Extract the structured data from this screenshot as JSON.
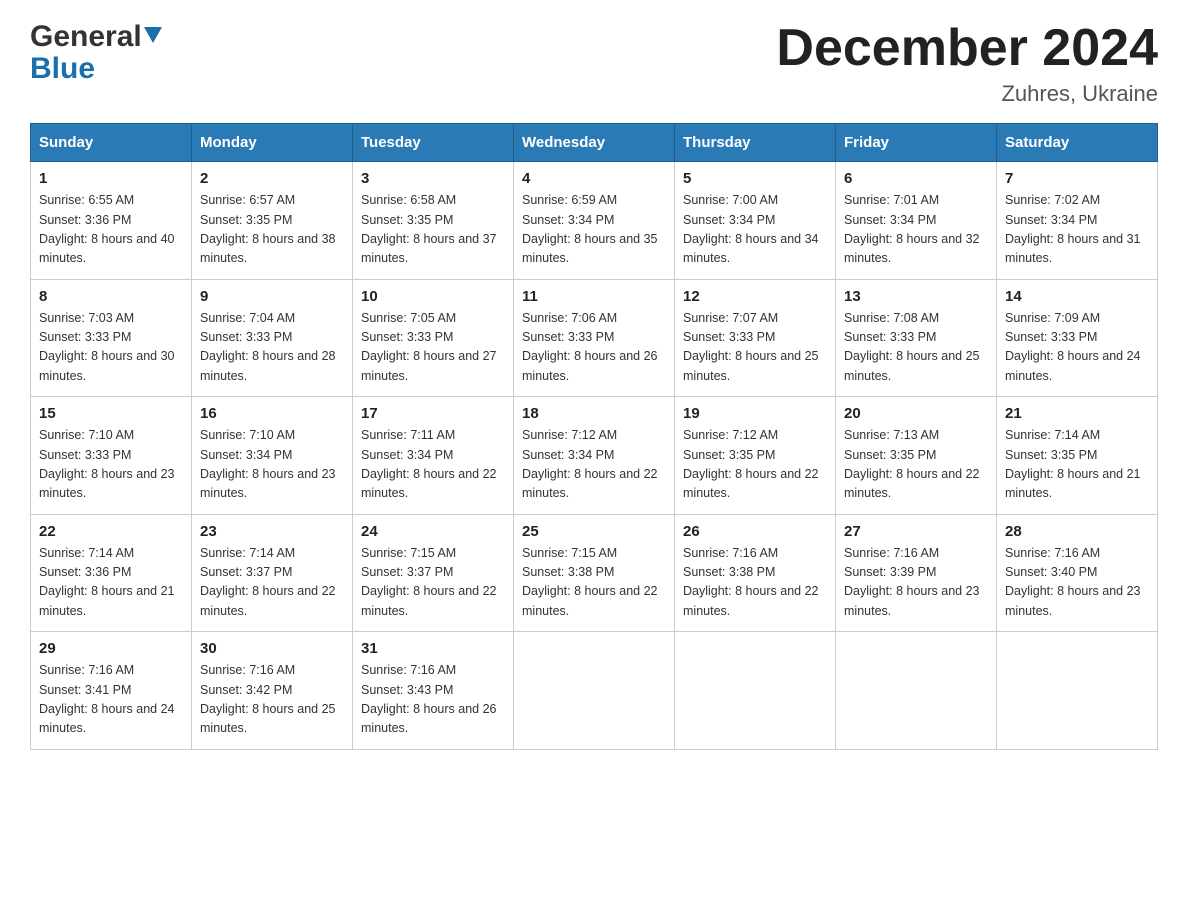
{
  "header": {
    "logo_general": "General",
    "logo_blue": "Blue",
    "month_title": "December 2024",
    "location": "Zuhres, Ukraine"
  },
  "days_of_week": [
    "Sunday",
    "Monday",
    "Tuesday",
    "Wednesday",
    "Thursday",
    "Friday",
    "Saturday"
  ],
  "weeks": [
    [
      {
        "day": "1",
        "sunrise": "6:55 AM",
        "sunset": "3:36 PM",
        "daylight": "8 hours and 40 minutes."
      },
      {
        "day": "2",
        "sunrise": "6:57 AM",
        "sunset": "3:35 PM",
        "daylight": "8 hours and 38 minutes."
      },
      {
        "day": "3",
        "sunrise": "6:58 AM",
        "sunset": "3:35 PM",
        "daylight": "8 hours and 37 minutes."
      },
      {
        "day": "4",
        "sunrise": "6:59 AM",
        "sunset": "3:34 PM",
        "daylight": "8 hours and 35 minutes."
      },
      {
        "day": "5",
        "sunrise": "7:00 AM",
        "sunset": "3:34 PM",
        "daylight": "8 hours and 34 minutes."
      },
      {
        "day": "6",
        "sunrise": "7:01 AM",
        "sunset": "3:34 PM",
        "daylight": "8 hours and 32 minutes."
      },
      {
        "day": "7",
        "sunrise": "7:02 AM",
        "sunset": "3:34 PM",
        "daylight": "8 hours and 31 minutes."
      }
    ],
    [
      {
        "day": "8",
        "sunrise": "7:03 AM",
        "sunset": "3:33 PM",
        "daylight": "8 hours and 30 minutes."
      },
      {
        "day": "9",
        "sunrise": "7:04 AM",
        "sunset": "3:33 PM",
        "daylight": "8 hours and 28 minutes."
      },
      {
        "day": "10",
        "sunrise": "7:05 AM",
        "sunset": "3:33 PM",
        "daylight": "8 hours and 27 minutes."
      },
      {
        "day": "11",
        "sunrise": "7:06 AM",
        "sunset": "3:33 PM",
        "daylight": "8 hours and 26 minutes."
      },
      {
        "day": "12",
        "sunrise": "7:07 AM",
        "sunset": "3:33 PM",
        "daylight": "8 hours and 25 minutes."
      },
      {
        "day": "13",
        "sunrise": "7:08 AM",
        "sunset": "3:33 PM",
        "daylight": "8 hours and 25 minutes."
      },
      {
        "day": "14",
        "sunrise": "7:09 AM",
        "sunset": "3:33 PM",
        "daylight": "8 hours and 24 minutes."
      }
    ],
    [
      {
        "day": "15",
        "sunrise": "7:10 AM",
        "sunset": "3:33 PM",
        "daylight": "8 hours and 23 minutes."
      },
      {
        "day": "16",
        "sunrise": "7:10 AM",
        "sunset": "3:34 PM",
        "daylight": "8 hours and 23 minutes."
      },
      {
        "day": "17",
        "sunrise": "7:11 AM",
        "sunset": "3:34 PM",
        "daylight": "8 hours and 22 minutes."
      },
      {
        "day": "18",
        "sunrise": "7:12 AM",
        "sunset": "3:34 PM",
        "daylight": "8 hours and 22 minutes."
      },
      {
        "day": "19",
        "sunrise": "7:12 AM",
        "sunset": "3:35 PM",
        "daylight": "8 hours and 22 minutes."
      },
      {
        "day": "20",
        "sunrise": "7:13 AM",
        "sunset": "3:35 PM",
        "daylight": "8 hours and 22 minutes."
      },
      {
        "day": "21",
        "sunrise": "7:14 AM",
        "sunset": "3:35 PM",
        "daylight": "8 hours and 21 minutes."
      }
    ],
    [
      {
        "day": "22",
        "sunrise": "7:14 AM",
        "sunset": "3:36 PM",
        "daylight": "8 hours and 21 minutes."
      },
      {
        "day": "23",
        "sunrise": "7:14 AM",
        "sunset": "3:37 PM",
        "daylight": "8 hours and 22 minutes."
      },
      {
        "day": "24",
        "sunrise": "7:15 AM",
        "sunset": "3:37 PM",
        "daylight": "8 hours and 22 minutes."
      },
      {
        "day": "25",
        "sunrise": "7:15 AM",
        "sunset": "3:38 PM",
        "daylight": "8 hours and 22 minutes."
      },
      {
        "day": "26",
        "sunrise": "7:16 AM",
        "sunset": "3:38 PM",
        "daylight": "8 hours and 22 minutes."
      },
      {
        "day": "27",
        "sunrise": "7:16 AM",
        "sunset": "3:39 PM",
        "daylight": "8 hours and 23 minutes."
      },
      {
        "day": "28",
        "sunrise": "7:16 AM",
        "sunset": "3:40 PM",
        "daylight": "8 hours and 23 minutes."
      }
    ],
    [
      {
        "day": "29",
        "sunrise": "7:16 AM",
        "sunset": "3:41 PM",
        "daylight": "8 hours and 24 minutes."
      },
      {
        "day": "30",
        "sunrise": "7:16 AM",
        "sunset": "3:42 PM",
        "daylight": "8 hours and 25 minutes."
      },
      {
        "day": "31",
        "sunrise": "7:16 AM",
        "sunset": "3:43 PM",
        "daylight": "8 hours and 26 minutes."
      },
      null,
      null,
      null,
      null
    ]
  ]
}
